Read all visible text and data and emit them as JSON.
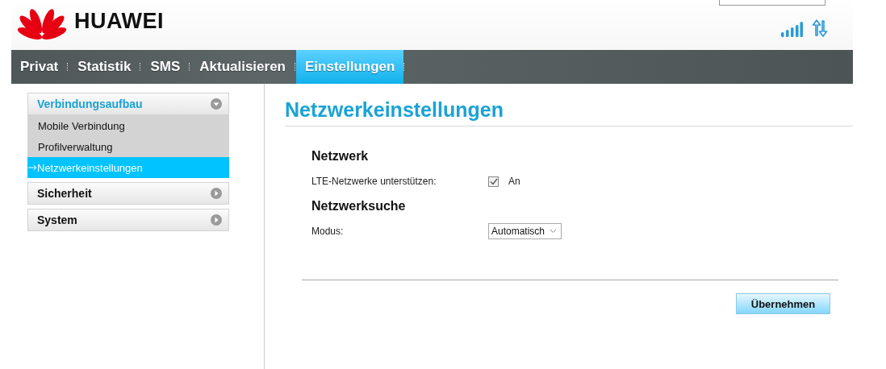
{
  "header": {
    "brand": "HUAWEI"
  },
  "nav": [
    {
      "label": "Privat",
      "selected": false
    },
    {
      "label": "Statistik",
      "selected": false
    },
    {
      "label": "SMS",
      "selected": false
    },
    {
      "label": "Aktualisieren",
      "selected": false
    },
    {
      "label": "Einstellungen",
      "selected": true
    }
  ],
  "sidebar": {
    "groups": [
      {
        "label": "Verbindungsaufbau",
        "expanded": true,
        "items": [
          {
            "label": "Mobile Verbindung",
            "selected": false
          },
          {
            "label": "Profilverwaltung",
            "selected": false
          },
          {
            "label": "Netzwerkeinstellungen",
            "selected": true
          }
        ]
      },
      {
        "label": "Sicherheit",
        "expanded": false
      },
      {
        "label": "System",
        "expanded": false
      }
    ]
  },
  "page": {
    "title": "Netzwerkeinstellungen",
    "sections": [
      {
        "heading": "Netzwerk",
        "rows": [
          {
            "kind": "checkbox",
            "label": "LTE-Netzwerke unterstützen:",
            "checked": true,
            "value": "An"
          }
        ]
      },
      {
        "heading": "Netzwerksuche",
        "rows": [
          {
            "kind": "select",
            "label": "Modus:",
            "value": "Automatisch"
          }
        ]
      }
    ],
    "apply_button": "Übernehmen"
  }
}
